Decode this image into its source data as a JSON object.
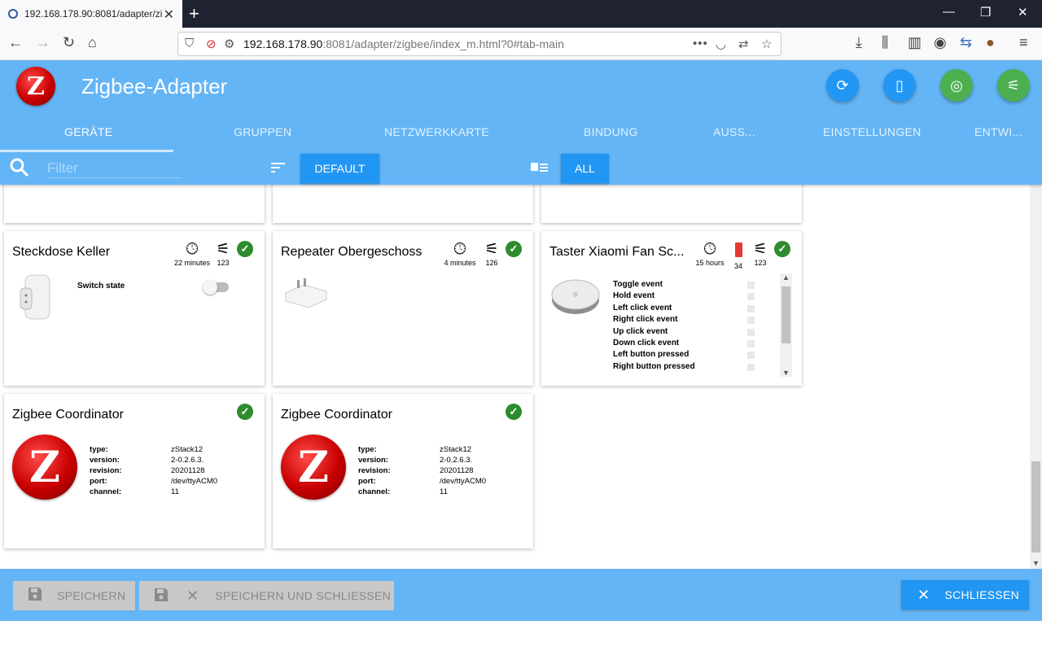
{
  "browser": {
    "tab_title": "192.168.178.90:8081/adapter/zigbee/index_m.html?0#tab-main",
    "url_host": "192.168.178.90",
    "url_path": ":8081/adapter/zigbee/index_m.html?0#tab-main"
  },
  "app": {
    "title": "Zigbee-Adapter",
    "logo_letter": "Z",
    "tabs": [
      "GERÄTE",
      "GRUPPEN",
      "NETZWERKKARTE",
      "BINDUNG",
      "AUSS...",
      "EINSTELLUNGEN",
      "ENTWI..."
    ]
  },
  "toolbar": {
    "filter_placeholder": "Filter",
    "sort_label": "DEFAULT",
    "view_label": "ALL"
  },
  "cards": {
    "steckdose": {
      "title": "Steckdose Keller",
      "last_seen": "22 minutes",
      "link_quality": "123",
      "state_label": "Switch state",
      "switch_on": false
    },
    "repeater": {
      "title": "Repeater Obergeschoss",
      "last_seen": "4 minutes",
      "link_quality": "126"
    },
    "taster": {
      "title": "Taster Xiaomi Fan Sc...",
      "last_seen": "15 hours",
      "battery": "34",
      "link_quality": "123",
      "events": [
        "Toggle event",
        "Hold event",
        "Left click event",
        "Right click event",
        "Up click event",
        "Down click event",
        "Left button pressed",
        "Right button pressed"
      ]
    },
    "coordinator1": {
      "title": "Zigbee Coordinator",
      "type_label": "type:",
      "type": "zStack12",
      "version_label": "version:",
      "version": "2-0.2.6.3.",
      "revision_label": "revision:",
      "revision": "20201128",
      "port_label": "port:",
      "port": "/dev/ttyACM0",
      "channel_label": "channel:",
      "channel": "11"
    },
    "coordinator2": {
      "title": "Zigbee Coordinator",
      "type_label": "type:",
      "type": "zStack12",
      "version_label": "version:",
      "version": "2-0.2.6.3.",
      "revision_label": "revision:",
      "revision": "20201128",
      "port_label": "port:",
      "port": "/dev/ttyACM0",
      "channel_label": "channel:",
      "channel": "11"
    }
  },
  "footer": {
    "save_label": "SPEICHERN",
    "save_close_label": "SPEICHERN UND SCHLIESSEN",
    "close_label": "SCHLIESSEN"
  },
  "colors": {
    "header": "#64b5f6",
    "accent": "#2196f3",
    "ok": "#2e8b2e",
    "battery": "#e53935"
  }
}
